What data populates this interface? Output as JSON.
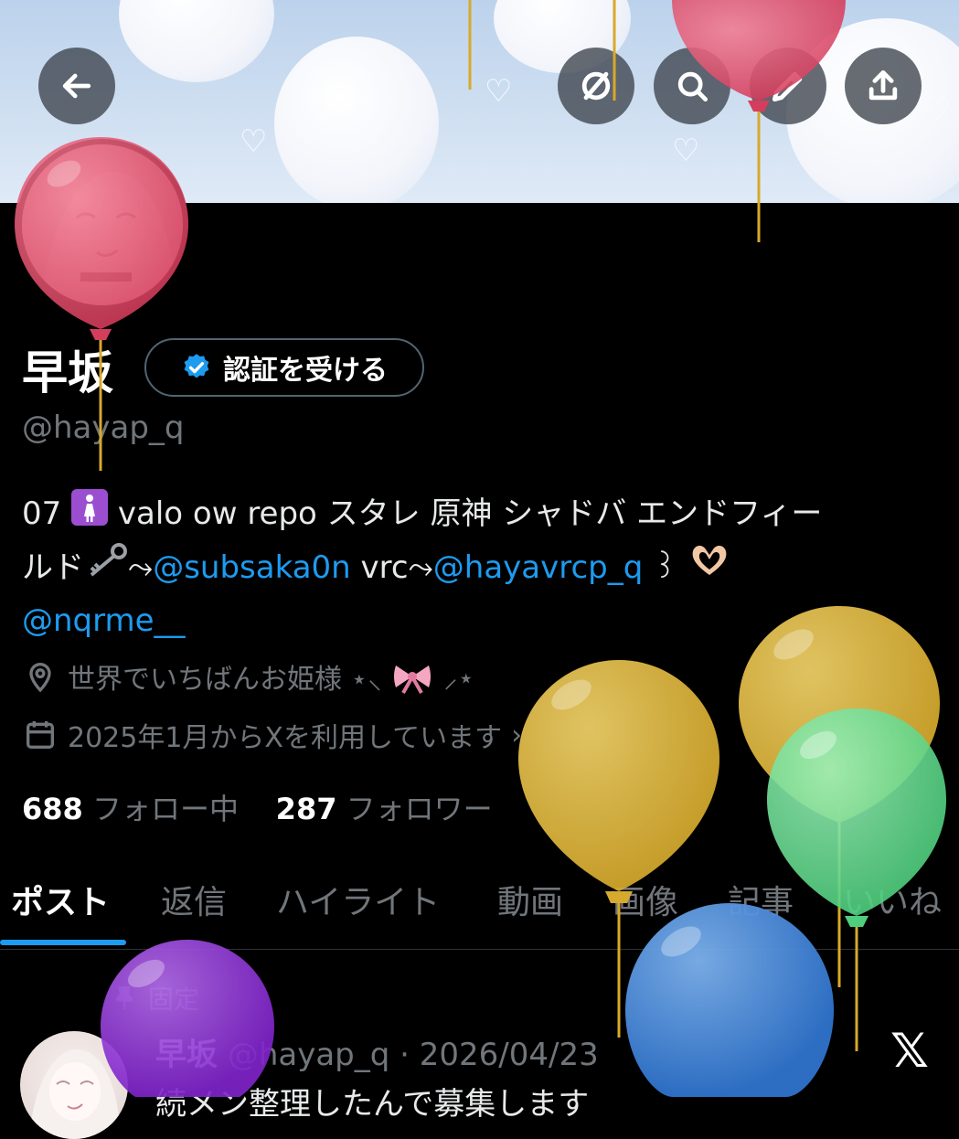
{
  "header": {
    "back_icon": "arrow-left-icon",
    "actions": [
      "stop-sharing-icon",
      "search-icon",
      "edit-icon",
      "share-icon"
    ]
  },
  "profile": {
    "name": "早坂",
    "verify_button": "認証を受ける",
    "handle": "@hayap_q",
    "bio": {
      "line1_prefix": "07",
      "line1_rest": "valo ow repo スタレ 原神 シャドバ エンドフィー",
      "line2_a": "ルド",
      "line2_sep1": "⤳",
      "link1": "@subsaka0n",
      "line2_b": " vrc",
      "line2_sep2": "⤳",
      "link2": "@hayavrcp_q",
      "line2_c": " ꒱",
      "link3": "@nqrme__"
    },
    "location": "世界でいちばんお姫様 ⋆⸜",
    "location_end": "⸝⋆",
    "joined": "2025年1月からXを利用しています",
    "joined_chevron": "›",
    "following_count": "688",
    "following_label": "フォロー中",
    "followers_count": "287",
    "followers_label": "フォロワー"
  },
  "tabs": [
    "ポスト",
    "返信",
    "ハイライト",
    "動画",
    "画像",
    "記事",
    "いいね"
  ],
  "active_tab": "ポスト",
  "post": {
    "pinned_label": "固定",
    "author": "早坂",
    "handle_date": "@hayap_q · 2026/04/23",
    "text": "続メン整理したんで募集します",
    "x_logo": "𝕏"
  },
  "colors": {
    "accent": "#1d9bf0",
    "balloon_red": "#e2536f",
    "balloon_yellow": "#e5bd3e",
    "balloon_green": "#6fdf97",
    "balloon_blue": "#3f85da",
    "balloon_purple": "#8f36d8"
  }
}
